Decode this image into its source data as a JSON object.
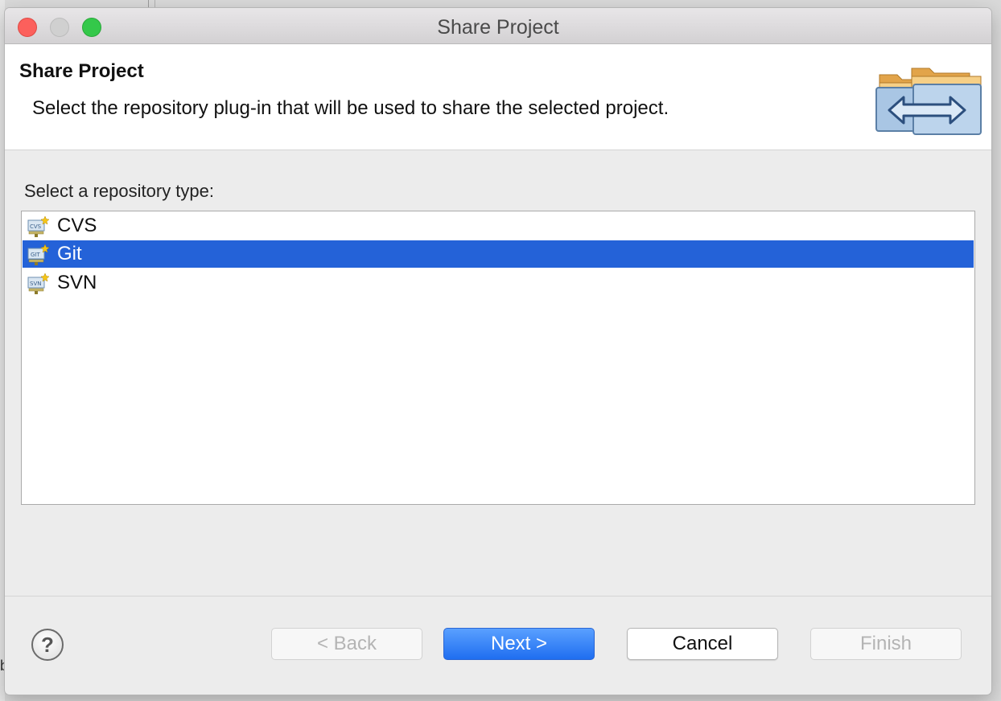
{
  "window": {
    "title": "Share Project"
  },
  "header": {
    "title": "Share Project",
    "description": "Select the repository plug-in that will be used to share the selected project."
  },
  "list": {
    "label": "Select a repository type:",
    "items": [
      {
        "label": "CVS",
        "icon": "cvs-repository-icon",
        "badge": "CVS",
        "selected": false
      },
      {
        "label": "Git",
        "icon": "git-repository-icon",
        "badge": "GIT",
        "selected": true
      },
      {
        "label": "SVN",
        "icon": "svn-repository-icon",
        "badge": "SVN",
        "selected": false
      }
    ]
  },
  "buttons": {
    "back": "< Back",
    "next": "Next >",
    "cancel": "Cancel",
    "finish": "Finish",
    "help": "?"
  },
  "colors": {
    "selection": "#2462d8",
    "primary_button": "#2f7cf6",
    "close": "#fc605c",
    "maximize": "#34c84a"
  }
}
